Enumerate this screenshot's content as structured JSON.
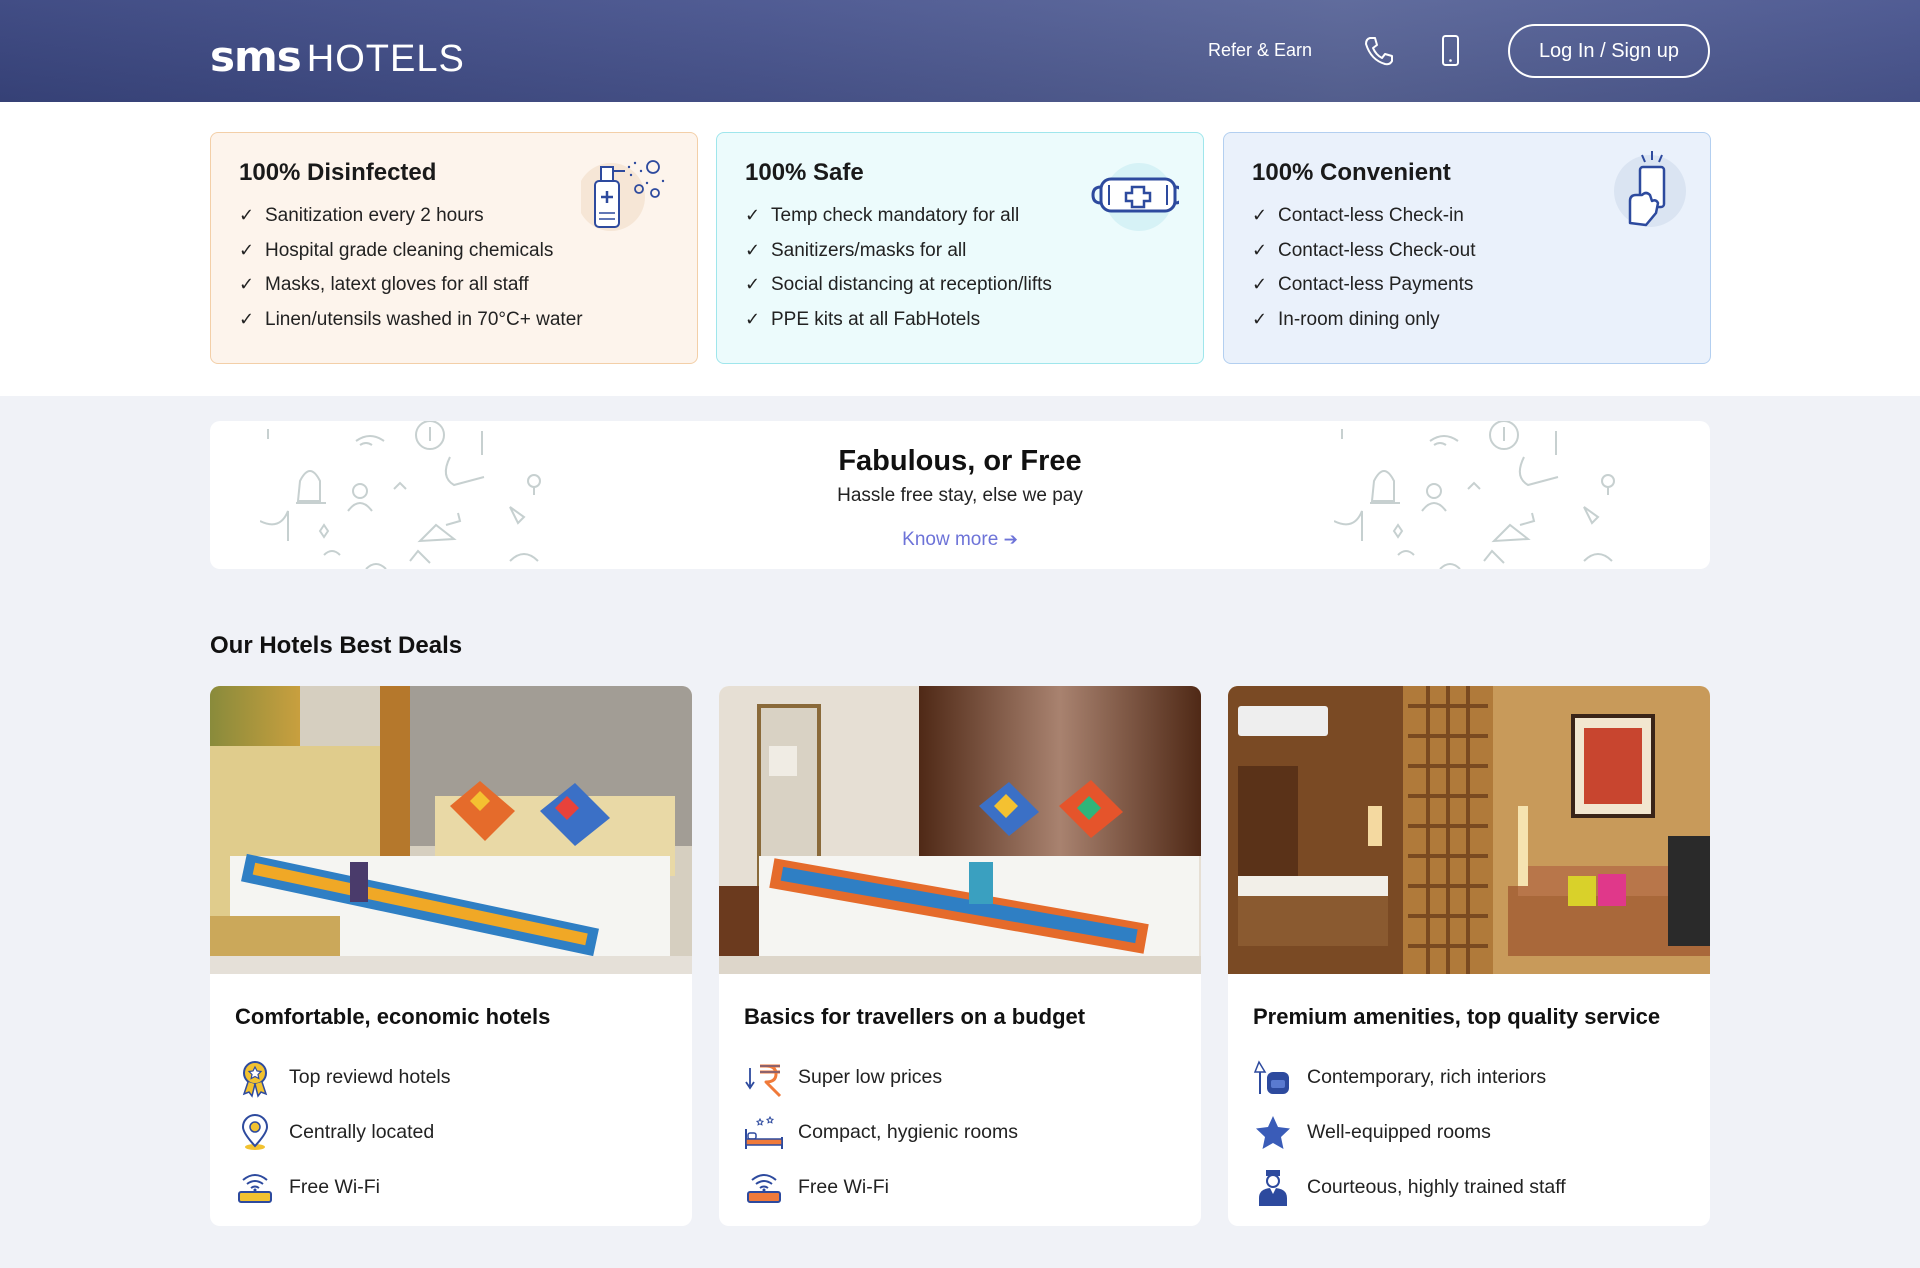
{
  "header": {
    "logo_bold": "sms",
    "logo_light": "HOTELS",
    "refer_label": "Refer & Earn",
    "phone_icon": "phone-icon",
    "mobile_icon": "mobile-icon",
    "login_label": "Log In / Sign up"
  },
  "safety": [
    {
      "title": "100% Disinfected",
      "icon": "sanitizer-spray-icon",
      "items": [
        "Sanitization every 2 hours",
        "Hospital grade cleaning chemicals",
        "Masks, latext gloves for all staff",
        "Linen/utensils washed in 70°C+ water"
      ]
    },
    {
      "title": "100% Safe",
      "icon": "face-mask-icon",
      "items": [
        "Temp check mandatory for all",
        "Sanitizers/masks for all",
        "Social distancing at reception/lifts",
        "PPE kits at all FabHotels"
      ]
    },
    {
      "title": "100% Convenient",
      "icon": "contactless-hand-icon",
      "items": [
        "Contact-less Check-in",
        "Contact-less Check-out",
        "Contact-less Payments",
        "In-room dining only"
      ]
    }
  ],
  "check_glyph": "✓",
  "banner": {
    "title": "Fabulous, or Free",
    "subtitle": "Hassle free stay, else we pay",
    "link": "Know more",
    "link_arrow": "➔"
  },
  "deals": {
    "title": "Our Hotels Best Deals",
    "cards": [
      {
        "title": "Comfortable, economic hotels",
        "features": [
          {
            "icon": "award-badge-icon",
            "label": "Top reviewd hotels"
          },
          {
            "icon": "location-pin-icon",
            "label": "Centrally located"
          },
          {
            "icon": "wifi-router-icon",
            "label": "Free Wi-Fi"
          }
        ]
      },
      {
        "title": "Basics for travellers on a budget",
        "features": [
          {
            "icon": "rupee-down-icon",
            "label": "Super low prices"
          },
          {
            "icon": "bed-stars-icon",
            "label": "Compact, hygienic rooms"
          },
          {
            "icon": "wifi-router-icon",
            "label": "Free Wi-Fi"
          }
        ]
      },
      {
        "title": "Premium amenities, top quality service",
        "features": [
          {
            "icon": "armchair-lamp-icon",
            "label": "Contemporary, rich interiors"
          },
          {
            "icon": "star-icon",
            "label": "Well-equipped rooms"
          },
          {
            "icon": "staff-person-icon",
            "label": "Courteous, highly trained staff"
          }
        ]
      }
    ]
  },
  "colors": {
    "header": "#4a5690",
    "link": "#6d73d8",
    "icon_blue": "#2d4a9e",
    "icon_yellow": "#f2c230",
    "icon_orange": "#f07a3a"
  }
}
